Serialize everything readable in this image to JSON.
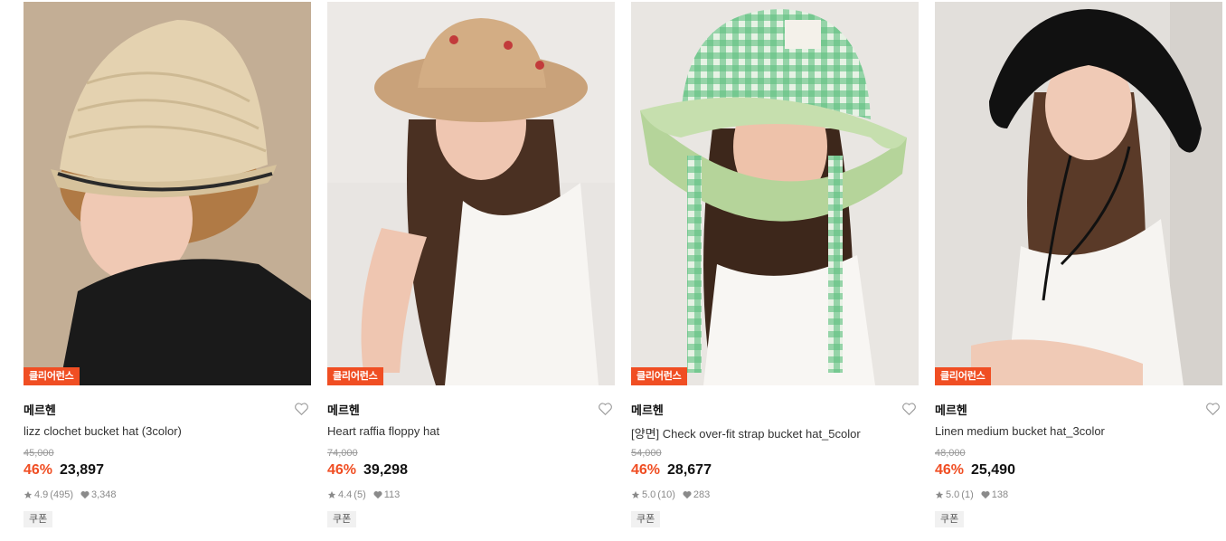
{
  "colors": {
    "accent": "#f04e23",
    "badge_bg": "#f04e23"
  },
  "products": [
    {
      "badge": "클리어런스",
      "brand": "메르헨",
      "name": "lizz clochet bucket hat (3color)",
      "original_price": "45,000",
      "discount": "46%",
      "price": "23,897",
      "rating": "4.9",
      "reviews": "(495)",
      "likes": "3,348",
      "coupon": "쿠폰"
    },
    {
      "badge": "클리어런스",
      "brand": "메르헨",
      "name": "Heart raffia floppy hat",
      "original_price": "74,000",
      "discount": "46%",
      "price": "39,298",
      "rating": "4.4",
      "reviews": "(5)",
      "likes": "113",
      "coupon": "쿠폰"
    },
    {
      "badge": "클리어런스",
      "brand": "메르헨",
      "name": "[양면] Check over-fit strap bucket hat_5color",
      "original_price": "54,000",
      "discount": "46%",
      "price": "28,677",
      "rating": "5.0",
      "reviews": "(10)",
      "likes": "283",
      "coupon": "쿠폰"
    },
    {
      "badge": "클리어런스",
      "brand": "메르헨",
      "name": "Linen medium bucket hat_3color",
      "original_price": "48,000",
      "discount": "46%",
      "price": "25,490",
      "rating": "5.0",
      "reviews": "(1)",
      "likes": "138",
      "coupon": "쿠폰"
    }
  ]
}
